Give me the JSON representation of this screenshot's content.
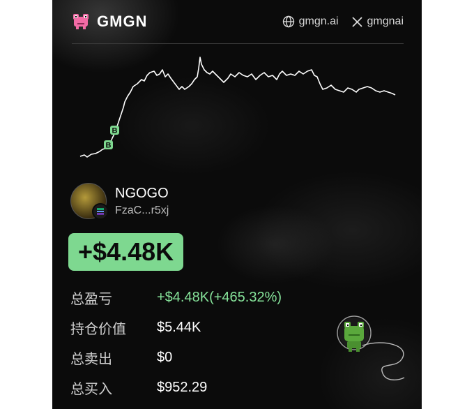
{
  "header": {
    "brand": "GMGN",
    "links": [
      {
        "icon": "globe-icon",
        "label": "gmgn.ai"
      },
      {
        "icon": "x-logo-icon",
        "label": "gmgnai"
      }
    ]
  },
  "chart": {
    "markers": [
      "B",
      "B"
    ],
    "colors": {
      "line": "#ffffff",
      "marker": "#7ed890"
    }
  },
  "user": {
    "name": "NGOGO",
    "address": "FzaC...r5xj",
    "chain_icon": "solana-icon"
  },
  "pnl": {
    "headline": "+$4.48K"
  },
  "stats": [
    {
      "label": "总盈亏",
      "value": "+$4.48K(+465.32%)",
      "color": "#86e39a"
    },
    {
      "label": "持仓价值",
      "value": "$5.44K",
      "color": "#ffffff"
    },
    {
      "label": "总卖出",
      "value": "$0",
      "color": "#ffffff"
    },
    {
      "label": "总买入",
      "value": "$952.29",
      "color": "#ffffff"
    }
  ],
  "colors": {
    "background": "#0b0b0b",
    "accent": "#7ed890"
  }
}
